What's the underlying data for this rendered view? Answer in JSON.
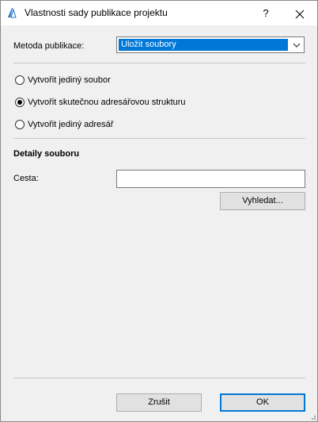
{
  "window": {
    "title": "Vlastnosti sady publikace projektu",
    "help_label": "?",
    "icon": "archicad-logo-icon"
  },
  "method": {
    "label": "Metoda publikace:",
    "selected": "Uložit soubory"
  },
  "options": [
    {
      "label": "Vytvořit jediný soubor",
      "checked": false
    },
    {
      "label": "Vytvořit skutečnou adresářovou strukturu",
      "checked": true
    },
    {
      "label": "Vytvořit jediný adresář",
      "checked": false
    }
  ],
  "details": {
    "heading": "Detaily souboru",
    "path_label": "Cesta:",
    "path_value": "",
    "browse_label": "Vyhledat..."
  },
  "footer": {
    "cancel_label": "Zrušit",
    "ok_label": "OK"
  },
  "colors": {
    "accent": "#0078d7",
    "window_bg": "#f0f0f0"
  }
}
